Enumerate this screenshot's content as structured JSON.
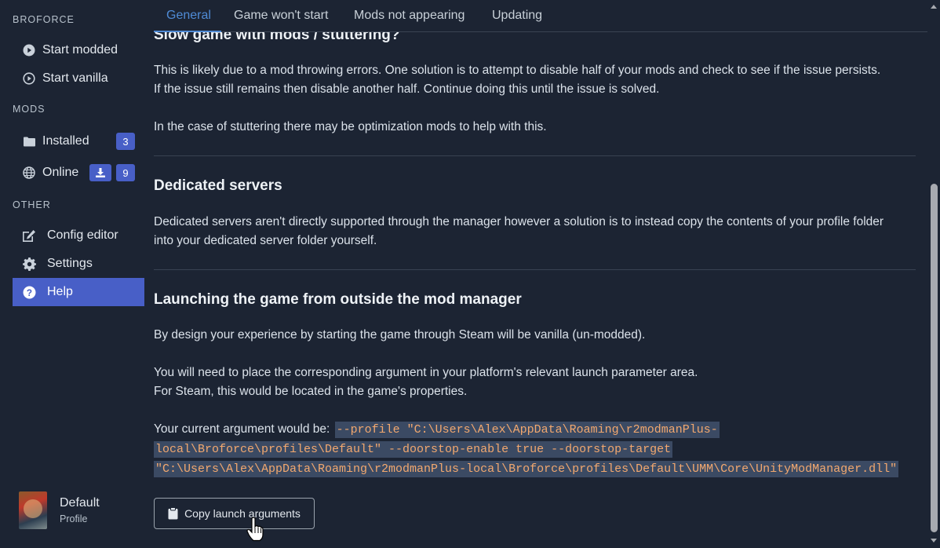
{
  "sidebar": {
    "sections": [
      {
        "label": "BROFORCE"
      },
      {
        "label": "MODS"
      },
      {
        "label": "OTHER"
      }
    ],
    "items": [
      {
        "label": "Start modded",
        "icon": "play-circle-icon"
      },
      {
        "label": "Start vanilla",
        "icon": "play-circle-outline-icon"
      },
      {
        "label": "Installed",
        "icon": "folder-icon",
        "badge": "3"
      },
      {
        "label": "Online",
        "icon": "globe-icon",
        "badge": "9",
        "download_icon": "download-icon"
      },
      {
        "label": "Config editor",
        "icon": "edit-icon"
      },
      {
        "label": "Settings",
        "icon": "gear-icon"
      },
      {
        "label": "Help",
        "icon": "question-circle-icon",
        "active": true
      }
    ],
    "profile": {
      "name": "Default",
      "subtitle": "Profile"
    }
  },
  "tabs": [
    {
      "label": "General",
      "active": true
    },
    {
      "label": "Game won't start"
    },
    {
      "label": "Mods not appearing"
    },
    {
      "label": "Updating"
    }
  ],
  "content": {
    "slow": {
      "heading": "Slow game with mods / stuttering?",
      "p1_line1": "This is likely due to a mod throwing errors. One solution is to attempt to disable half of your mods and check to see if the issue persists.",
      "p1_line2": "If the issue still remains then disable another half. Continue doing this until the issue is solved.",
      "p2": "In the case of stuttering there may be optimization mods to help with this."
    },
    "dedicated": {
      "heading": "Dedicated servers",
      "p_line1": "Dedicated servers aren't directly supported through the manager however a solution is to instead copy the contents of your profile folder",
      "p_line2": "into your dedicated server folder yourself."
    },
    "launching": {
      "heading": "Launching the game from outside the mod manager",
      "p1": "By design your experience by starting the game through Steam will be vanilla (un-modded).",
      "p2_line1": "You will need to place the corresponding argument in your platform's relevant launch parameter area.",
      "p2_line2": "For Steam, this would be located in the game's properties.",
      "arg_label": "Your current argument would be:",
      "arg_line1": "--profile \"C:\\Users\\Alex\\AppData\\Roaming\\r2modmanPlus-",
      "arg_line2": "local\\Broforce\\profiles\\Default\" --doorstop-enable true --doorstop-target",
      "arg_line3": "\"C:\\Users\\Alex\\AppData\\Roaming\\r2modmanPlus-local\\Broforce\\profiles\\Default\\UMM\\Core\\UnityModManager.dll\"",
      "copy_button": "Copy launch arguments",
      "copy_icon": "clipboard-icon"
    }
  },
  "colors": {
    "background": "#1c2433",
    "accent": "#485fc7",
    "tab_active": "#4f8bd6",
    "code_text": "#f2a86f",
    "code_bg": "#3b4a63"
  }
}
